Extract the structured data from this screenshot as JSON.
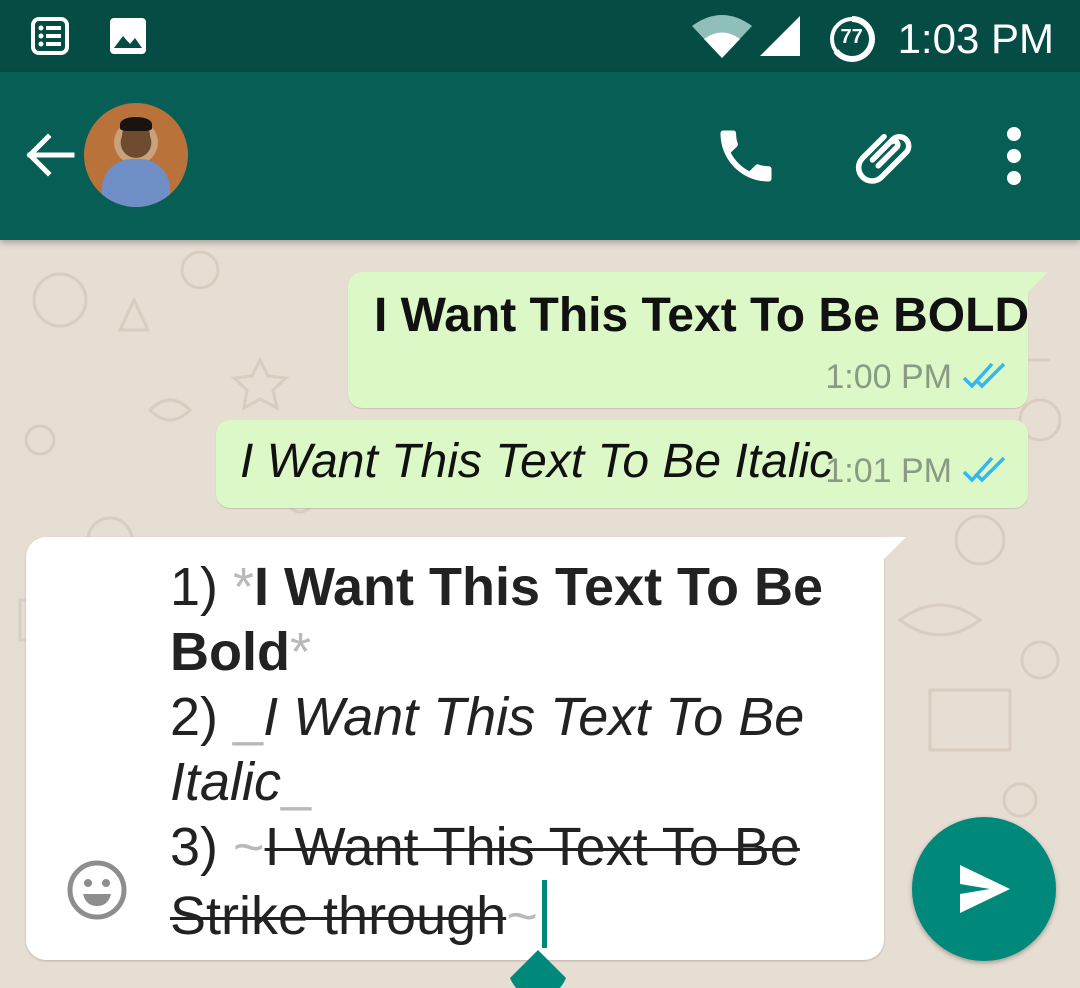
{
  "status_bar": {
    "time": "1:03 PM",
    "battery_level": "77",
    "icons": [
      "notes-icon",
      "image-icon",
      "wifi-icon",
      "cell-signal-icon",
      "battery-icon"
    ]
  },
  "header": {
    "icons": [
      "back-arrow-icon",
      "avatar",
      "phone-icon",
      "paperclip-icon",
      "more-vert-icon"
    ],
    "colors": {
      "statusbar": "#054d44",
      "appbar": "#075e54"
    }
  },
  "messages": [
    {
      "text": "I Want This Text To Be BOLD",
      "time": "1:00 PM",
      "style": "bold",
      "status_icon": "double-check-icon"
    },
    {
      "text": "I Want This Text To Be Italic",
      "time": "1:01 PM",
      "style": "italic",
      "status_icon": "double-check-icon"
    }
  ],
  "composer": {
    "line1_prefix": "1) ",
    "line1_mark_open": "*",
    "line1_text_a": "I Want This Text To Be",
    "line1_text_b": "Bold",
    "line1_mark_close": "*",
    "line2_prefix": "2) ",
    "line2_mark_open": "_",
    "line2_text_a": "I Want This Text To Be",
    "line2_text_b": "Italic",
    "line2_mark_close": "_",
    "line3_prefix": "3) ",
    "line3_mark_open": "~",
    "line3_text_a": "I Want This Text To Be",
    "line3_text_b": "Strike through",
    "line3_mark_close": "~"
  },
  "colors": {
    "outgoing_bubble": "#dcf8c6",
    "accent": "#00897b",
    "read_ticks": "#34b7f1",
    "chat_background": "#e6ddd3"
  }
}
